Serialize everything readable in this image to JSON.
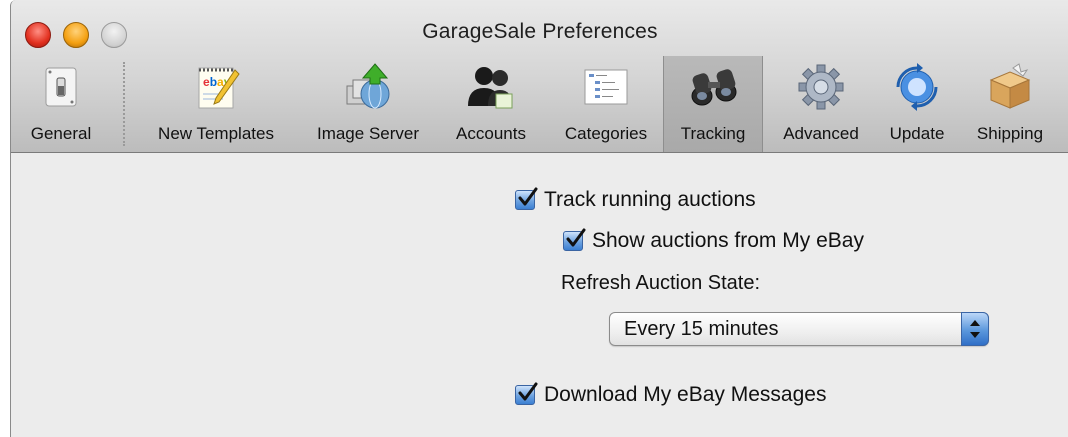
{
  "window": {
    "title": "GarageSale Preferences"
  },
  "toolbar": {
    "items": [
      {
        "label": "General",
        "icon": "light-switch-icon"
      },
      {
        "label": "New Templates",
        "icon": "ebay-notepad-icon"
      },
      {
        "label": "Image Server",
        "icon": "upload-globe-icon"
      },
      {
        "label": "Accounts",
        "icon": "people-icon"
      },
      {
        "label": "Categories",
        "icon": "category-tree-icon"
      },
      {
        "label": "Tracking",
        "icon": "binoculars-icon",
        "selected": true
      },
      {
        "label": "Advanced",
        "icon": "gear-icon"
      },
      {
        "label": "Update",
        "icon": "sync-icon"
      },
      {
        "label": "Shipping",
        "icon": "package-icon"
      }
    ]
  },
  "tracking": {
    "track_running": {
      "label": "Track running auctions",
      "checked": true
    },
    "show_from_my_ebay": {
      "label": "Show auctions from My eBay",
      "checked": true
    },
    "refresh_label": "Refresh Auction State:",
    "refresh_value": "Every 15 minutes",
    "download_messages": {
      "label": "Download My eBay Messages",
      "checked": true
    }
  },
  "colors": {
    "accent": "#3b7fd2",
    "selected_toolbar_bg": "#ababab"
  }
}
